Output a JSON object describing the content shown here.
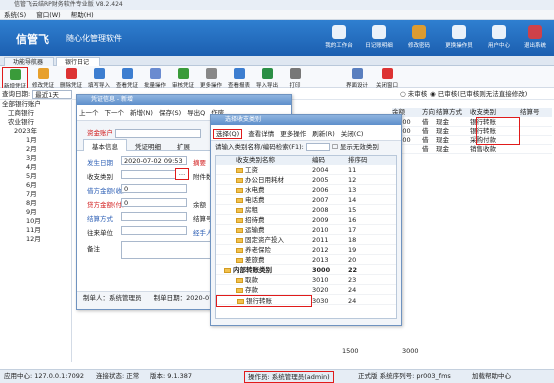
{
  "titlebar": {
    "title": "信管飞云结RP财务软件专业版 V8.2.424"
  },
  "menu": [
    "系统(S)",
    "窗口(W)",
    "帮助(H)"
  ],
  "banner": {
    "logo": "信管飞",
    "slogan": "随心化管理软件",
    "buttons": [
      "我的工作台",
      "日记账明细",
      "修改密码",
      "更换操作员",
      "用户中心",
      "退出系统"
    ]
  },
  "tabs": [
    "功能导航器",
    "银行日记账"
  ],
  "toolbar": [
    "新增凭证",
    "修改凭证",
    "删除凭证",
    "填写导入",
    "查看凭证",
    "批量操作",
    "审核凭证",
    "更多操作",
    "查看报表",
    "导入导出",
    "打印",
    "界面设计",
    "关闭窗口"
  ],
  "filter": {
    "label": "查询日期:",
    "value": "最近1天",
    "status_label": "未审核",
    "status2": "已审核(已审核则无法直接修改)"
  },
  "tree": [
    "全部银行账户",
    "工商银行",
    "农业银行",
    "2023年",
    "1月",
    "2月",
    "3月",
    "4月",
    "5月",
    "6月",
    "7月",
    "8月",
    "9月",
    "10月",
    "11月",
    "12月"
  ],
  "grid": {
    "headers": [
      "余额",
      "方向",
      "结算方式",
      "收支类别",
      "结算号"
    ],
    "rows": [
      [
        "2 500",
        "借",
        "现金",
        "银行转账",
        ""
      ],
      [
        "1 000",
        "借",
        "现金",
        "银行转账",
        ""
      ],
      [
        "3 000",
        "借",
        "现金",
        "采购付款",
        ""
      ],
      [
        "",
        "借",
        "现金",
        "销售收款",
        ""
      ]
    ],
    "footer": [
      "1500",
      "3000"
    ]
  },
  "voucher": {
    "title": "凭证信息 - 新增",
    "nav": [
      "上一个",
      "下一个",
      "新增(N)",
      "保存(S)",
      "导出Q",
      "作废"
    ],
    "account_label": "资金账户",
    "account_value": "",
    "tabs": [
      "基本信息",
      "凭证明细",
      "扩展"
    ],
    "fields": [
      [
        "发生日期",
        "2020-07-02 09:53"
      ],
      [
        "收支类别",
        ""
      ],
      [
        "借方金额(收)",
        "0"
      ],
      [
        "贷方金额(付)",
        "0"
      ],
      [
        "结算方式",
        ""
      ],
      [
        "往来单位",
        ""
      ],
      [
        "备注",
        ""
      ]
    ],
    "right_labels": [
      "摘要",
      "附件数",
      "",
      "余额",
      "结算号",
      "经手人"
    ],
    "maker": "制单人：系统管理员",
    "make_time": "制单日期：2020-07-02 09:53"
  },
  "picker": {
    "title": "选择收支类别",
    "buttons": [
      "选择(Q)",
      "查看详情",
      "更多操作",
      "刷新(R)",
      "关闭(C)"
    ],
    "search_label": "请输入类别名称/编码检索(F1):",
    "checkbox": "显示无效类别",
    "headers": [
      "收支类别名称",
      "编码",
      "排序码"
    ],
    "rows": [
      [
        "工资",
        "2004",
        "11"
      ],
      [
        "办公日用耗材",
        "2005",
        "12"
      ],
      [
        "水电费",
        "2006",
        "13"
      ],
      [
        "电话费",
        "2007",
        "14"
      ],
      [
        "房租",
        "2008",
        "15"
      ],
      [
        "招待费",
        "2009",
        "16"
      ],
      [
        "运输费",
        "2010",
        "17"
      ],
      [
        "固定资产投入",
        "2011",
        "18"
      ],
      [
        "养老保险",
        "2012",
        "19"
      ],
      [
        "差旅费",
        "2013",
        "20"
      ],
      [
        "内部转账类别",
        "3000",
        "22"
      ],
      [
        "取款",
        "3010",
        "23"
      ],
      [
        "存款",
        "3020",
        "24"
      ],
      [
        "银行转账",
        "3030",
        "24"
      ]
    ]
  },
  "status": {
    "server": "应用中心: 127.0.0.1:7092",
    "conn": "连接状态: 正常",
    "version": "版本: 9.1.387",
    "operator": "操作员: 系统管理员(admin)",
    "edition": "正式版 系统序列号: pr003_fms",
    "help": "加载帮助中心"
  }
}
